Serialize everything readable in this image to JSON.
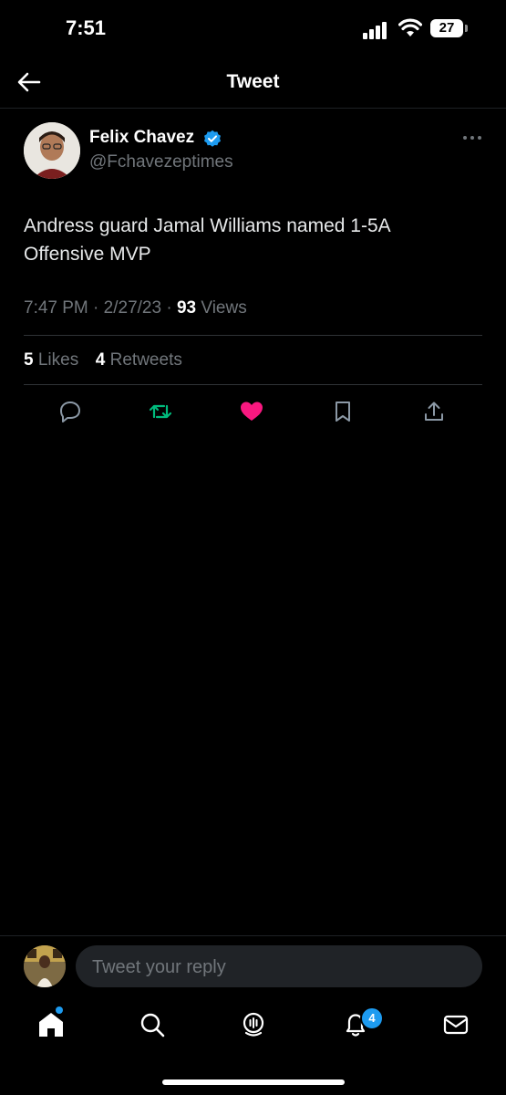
{
  "status_bar": {
    "time": "7:51",
    "battery": "27"
  },
  "header": {
    "title": "Tweet"
  },
  "author": {
    "name": "Felix Chavez",
    "handle": "@Fchavezeptimes"
  },
  "tweet": {
    "text": "Andress guard Jamal Williams named 1-5A Offensive MVP",
    "time": "7:47 PM",
    "date": "2/27/23",
    "views": "93",
    "views_label": "Views"
  },
  "stats": {
    "likes": "5",
    "likes_label": "Likes",
    "retweets": "4",
    "retweets_label": "Retweets"
  },
  "reply": {
    "placeholder": "Tweet your reply"
  },
  "nav": {
    "notifications_count": "4"
  },
  "colors": {
    "accent": "#1d9bf0",
    "retweet": "#00ba7c",
    "like": "#f91880",
    "muted": "#71767b"
  }
}
